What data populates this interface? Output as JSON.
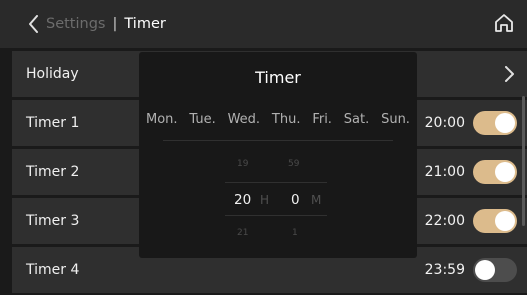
{
  "header": {
    "back_label": "Settings",
    "separator": "|",
    "title": "Timer",
    "back_icon": "chevron-left-icon",
    "home_icon": "home-icon"
  },
  "holiday": {
    "label": "Holiday",
    "icon": "chevron-right-icon"
  },
  "timers": [
    {
      "label": "Timer 1",
      "time": "20:00",
      "enabled": true
    },
    {
      "label": "Timer 2",
      "time": "21:00",
      "enabled": true
    },
    {
      "label": "Timer 3",
      "time": "22:00",
      "enabled": true
    },
    {
      "label": "Timer 4",
      "time": "23:59",
      "enabled": false
    }
  ],
  "dialog": {
    "title": "Timer",
    "days": [
      "Mon.",
      "Tue.",
      "Wed.",
      "Thu.",
      "Fri.",
      "Sat.",
      "Sun."
    ],
    "hour": {
      "prev": "19",
      "value": "20",
      "next": "21",
      "unit": "H"
    },
    "minute": {
      "prev": "59",
      "value": "0",
      "next": "1",
      "unit": "M"
    }
  },
  "colors": {
    "toggle_on": "#dcbb8c",
    "toggle_off": "#4d4d4d",
    "background": "#1a1a1a",
    "row": "#2f2f2f"
  }
}
